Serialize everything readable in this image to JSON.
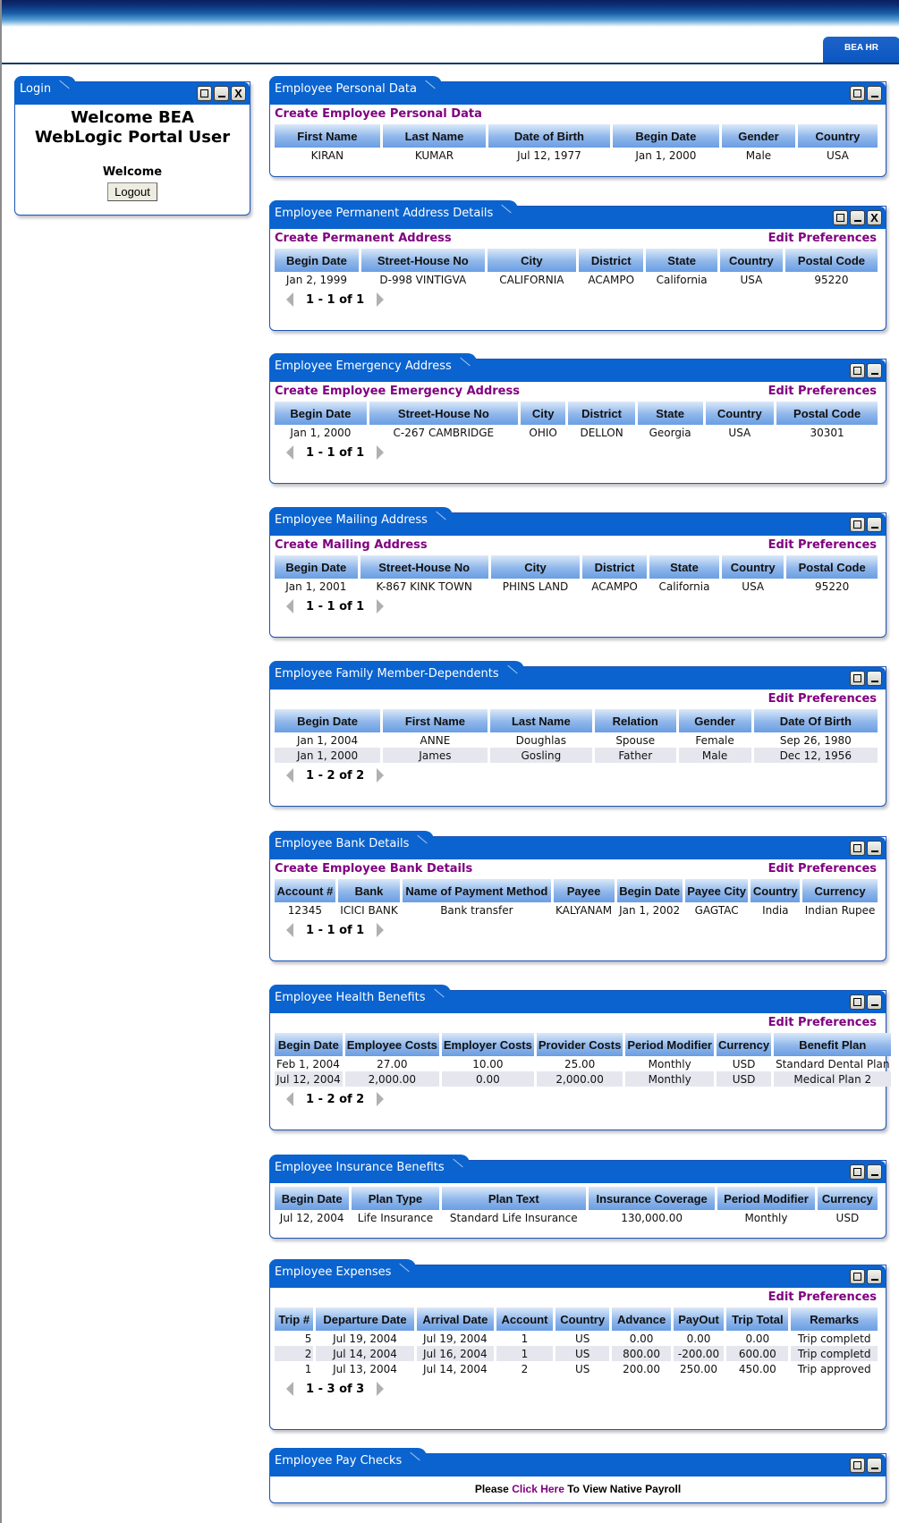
{
  "header": {
    "app_tab": "BEA HR"
  },
  "login": {
    "title": "Login",
    "heading": "Welcome BEA WebLogic Portal User",
    "welcome": "Welcome",
    "logout_label": "Logout"
  },
  "portlets": {
    "personal": {
      "title": "Employee Personal Data",
      "create_link": "Create Employee Personal Data",
      "columns": [
        "First Name",
        "Last Name",
        "Date of Birth",
        "Begin Date",
        "Gender",
        "Country"
      ],
      "rows": [
        [
          "KIRAN",
          "KUMAR",
          "Jul 12, 1977",
          "Jan 1, 2000",
          "Male",
          "USA"
        ]
      ]
    },
    "permanent": {
      "title": "Employee Permanent Address Details",
      "create_link": "Create Permanent Address",
      "edit_link": "Edit Preferences",
      "columns": [
        "Begin Date",
        "Street-House No",
        "City",
        "District",
        "State",
        "Country",
        "Postal Code"
      ],
      "rows": [
        [
          "Jan 2, 1999",
          "D-998 VINTIGVA",
          "CALIFORNIA",
          "ACAMPO",
          "California",
          "USA",
          "95220"
        ]
      ],
      "pager": "1 - 1 of 1"
    },
    "emergency": {
      "title": "Employee Emergency Address",
      "create_link": "Create Employee Emergency Address",
      "edit_link": "Edit Preferences",
      "columns": [
        "Begin Date",
        "Street-House No",
        "City",
        "District",
        "State",
        "Country",
        "Postal Code"
      ],
      "rows": [
        [
          "Jan 1, 2000",
          "C-267 CAMBRIDGE",
          "OHIO",
          "DELLON",
          "Georgia",
          "USA",
          "30301"
        ]
      ],
      "pager": "1 - 1 of 1"
    },
    "mailing": {
      "title": "Employee Mailing Address",
      "create_link": "Create Mailing Address",
      "edit_link": "Edit Preferences",
      "columns": [
        "Begin Date",
        "Street-House No",
        "City",
        "District",
        "State",
        "Country",
        "Postal Code"
      ],
      "rows": [
        [
          "Jan 1, 2001",
          "K-867 KINK TOWN",
          "PHINS LAND",
          "ACAMPO",
          "California",
          "USA",
          "95220"
        ]
      ],
      "pager": "1 - 1 of 1"
    },
    "family": {
      "title": "Employee Family Member-Dependents",
      "edit_link": "Edit Preferences",
      "columns": [
        "Begin Date",
        "First Name",
        "Last Name",
        "Relation",
        "Gender",
        "Date Of Birth"
      ],
      "rows": [
        [
          "Jan 1, 2004",
          "ANNE",
          "Doughlas",
          "Spouse",
          "Female",
          "Sep 26, 1980"
        ],
        [
          "Jan 1, 2000",
          "James",
          "Gosling",
          "Father",
          "Male",
          "Dec 12, 1956"
        ]
      ],
      "pager": "1 - 2 of 2"
    },
    "bank": {
      "title": "Employee Bank Details",
      "create_link": "Create Employee Bank Details",
      "edit_link": "Edit Preferences",
      "columns": [
        "Account #",
        "Bank",
        "Name of Payment Method",
        "Payee",
        "Begin Date",
        "Payee City",
        "Country",
        "Currency"
      ],
      "rows": [
        [
          "12345",
          "ICICI BANK",
          "Bank transfer",
          "KALYANAM",
          "Jan 1, 2002",
          "GAGTAC",
          "India",
          "Indian Rupee"
        ]
      ],
      "pager": "1 - 1 of 1"
    },
    "health": {
      "title": "Employee Health Benefits",
      "edit_link": "Edit Preferences",
      "columns": [
        "Begin Date",
        "Employee Costs",
        "Employer Costs",
        "Provider Costs",
        "Period Modifier",
        "Currency",
        "Benefit Plan"
      ],
      "rows": [
        [
          "Feb 1, 2004",
          "27.00",
          "10.00",
          "25.00",
          "Monthly",
          "USD",
          "Standard Dental Plan"
        ],
        [
          "Jul 12, 2004",
          "2,000.00",
          "0.00",
          "2,000.00",
          "Monthly",
          "USD",
          "Medical Plan 2"
        ]
      ],
      "pager": "1 - 2 of 2"
    },
    "insurance": {
      "title": "Employee Insurance Benefits",
      "columns": [
        "Begin Date",
        "Plan Type",
        "Plan Text",
        "Insurance Coverage",
        "Period Modifier",
        "Currency"
      ],
      "rows": [
        [
          "Jul 12, 2004",
          "Life Insurance",
          "Standard Life Insurance",
          "130,000.00",
          "Monthly",
          "USD"
        ]
      ]
    },
    "expenses": {
      "title": "Employee Expenses",
      "edit_link": "Edit Preferences",
      "columns": [
        "Trip #",
        "Departure Date",
        "Arrival Date",
        "Account",
        "Country",
        "Advance",
        "PayOut",
        "Trip Total",
        "Remarks"
      ],
      "rows": [
        [
          "5",
          "Jul 19, 2004",
          "Jul 19, 2004",
          "1",
          "US",
          "0.00",
          "0.00",
          "0.00",
          "Trip completd"
        ],
        [
          "2",
          "Jul 14, 2004",
          "Jul 16, 2004",
          "1",
          "US",
          "800.00",
          "-200.00",
          "600.00",
          "Trip completd"
        ],
        [
          "1",
          "Jul 13, 2004",
          "Jul 14, 2004",
          "2",
          "US",
          "200.00",
          "250.00",
          "450.00",
          "Trip approved"
        ]
      ],
      "pager": "1 - 3 of 3"
    },
    "paychecks": {
      "title": "Employee Pay Checks",
      "text_before": "Please ",
      "link": "Click Here",
      "text_after": " To View Native Payroll"
    }
  }
}
